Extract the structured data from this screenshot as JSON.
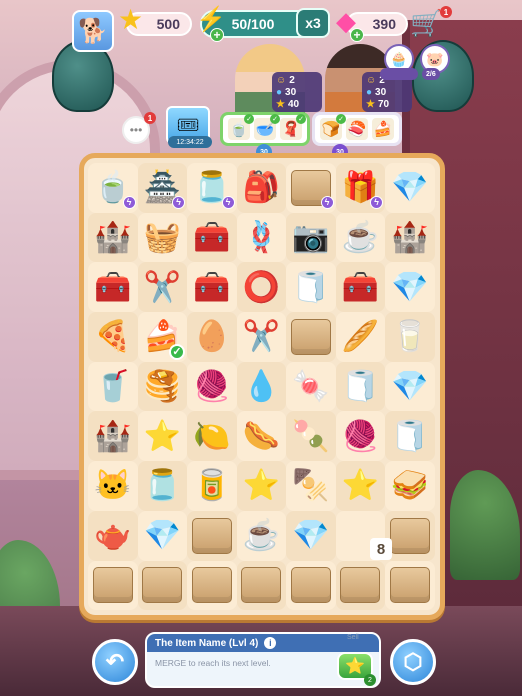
{
  "top_bar": {
    "avatar_icon": "🐕",
    "stars": "500",
    "energy": "50/100",
    "multiplier": "x3",
    "gems": "390",
    "cart_badge": "1"
  },
  "characters": {
    "left": {
      "level": "2",
      "coins": "30",
      "stars": "40"
    },
    "right": {
      "level": "2",
      "coins": "30",
      "stars": "70"
    },
    "pill_badge": "3",
    "progress_label": "2/6"
  },
  "orders": {
    "bubble_text": "•••",
    "bubble_badge": "1",
    "timer": "12:34:22",
    "token_a": "30",
    "token_b": "30"
  },
  "board": {
    "rows": [
      [
        "🍵",
        "🏯",
        "🫙",
        "🎒",
        "📦",
        "🎁",
        "💎"
      ],
      [
        "🏰",
        "🧺",
        "🧰",
        "🪢",
        "📷",
        "☕",
        "🏰"
      ],
      [
        "🧰",
        "✂️",
        "🧰",
        "⭕",
        "🧻",
        "🧰",
        "💎"
      ],
      [
        "🍕",
        "🍰",
        "🥚",
        "✂️",
        "📦",
        "🥖",
        "🥛"
      ],
      [
        "🥤",
        "🥞",
        "🧶",
        "💧",
        "🍬",
        "🧻",
        "💎"
      ],
      [
        "🏰",
        "⭐",
        "🍋",
        "🌭",
        "🍡",
        "🧶",
        "🧻"
      ],
      [
        "🐱",
        "🫙",
        "🥫",
        "⭐",
        "🍢",
        "⭐",
        "🥪"
      ],
      [
        "🫖",
        "💎",
        "📦",
        "☕",
        "💎",
        "",
        "📦"
      ],
      [
        "📦",
        "📦",
        "📦",
        "📦",
        "📦",
        "📦",
        "📦"
      ]
    ],
    "stack_count": "8"
  },
  "bottom_bar": {
    "item_title": "The Item Name (Lvl 4)",
    "item_desc": "MERGE to reach its next level.",
    "sell_label": "Sell",
    "sell_count": "2"
  }
}
